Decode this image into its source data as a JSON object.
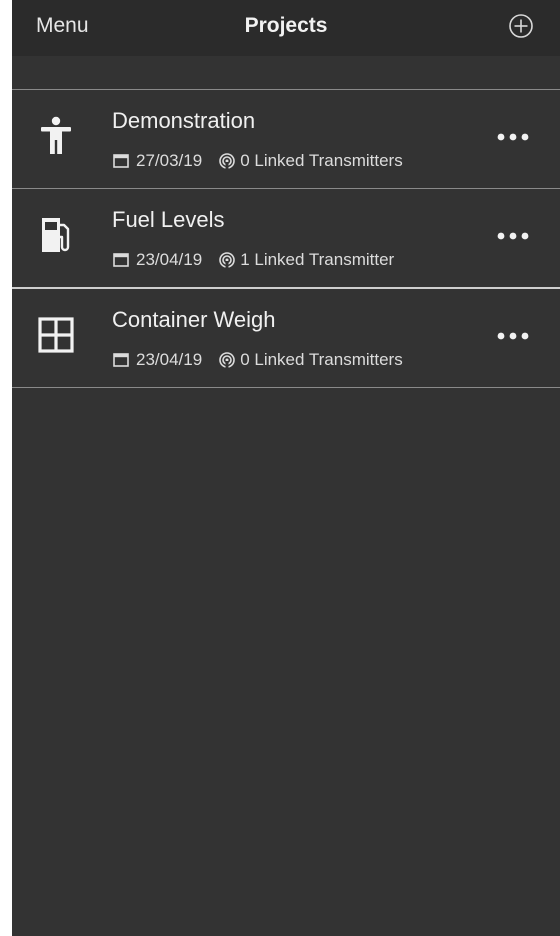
{
  "navbar": {
    "menu_label": "Menu",
    "title": "Projects",
    "add_icon": "plus-circle-icon"
  },
  "projects": [
    {
      "title": "Demonstration",
      "icon": "person-icon",
      "date": "27/03/19",
      "transmitters": "0 Linked Transmitters"
    },
    {
      "title": "Fuel Levels",
      "icon": "fuel-pump-icon",
      "date": "23/04/19",
      "transmitters": "1 Linked Transmitter"
    },
    {
      "title": "Container Weigh",
      "icon": "grid-icon",
      "date": "23/04/19",
      "transmitters": "0 Linked Transmitters"
    }
  ],
  "colors": {
    "background": "#333333",
    "navbar": "#2b2b2b",
    "text": "#f0f0f0",
    "separator": "#8a8a8a"
  }
}
